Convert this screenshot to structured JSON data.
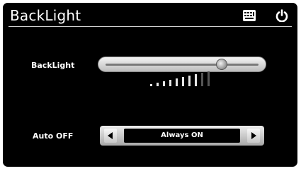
{
  "header": {
    "title": "BackLight",
    "icons": [
      "keyboard-icon",
      "power-icon"
    ]
  },
  "backlight": {
    "label": "BackLight",
    "level": 0.75
  },
  "auto_off": {
    "label": "Auto OFF",
    "value": "Always ON"
  },
  "colors": {
    "background": "#000000",
    "text": "#ffffff",
    "control": "#d6d6d6"
  }
}
